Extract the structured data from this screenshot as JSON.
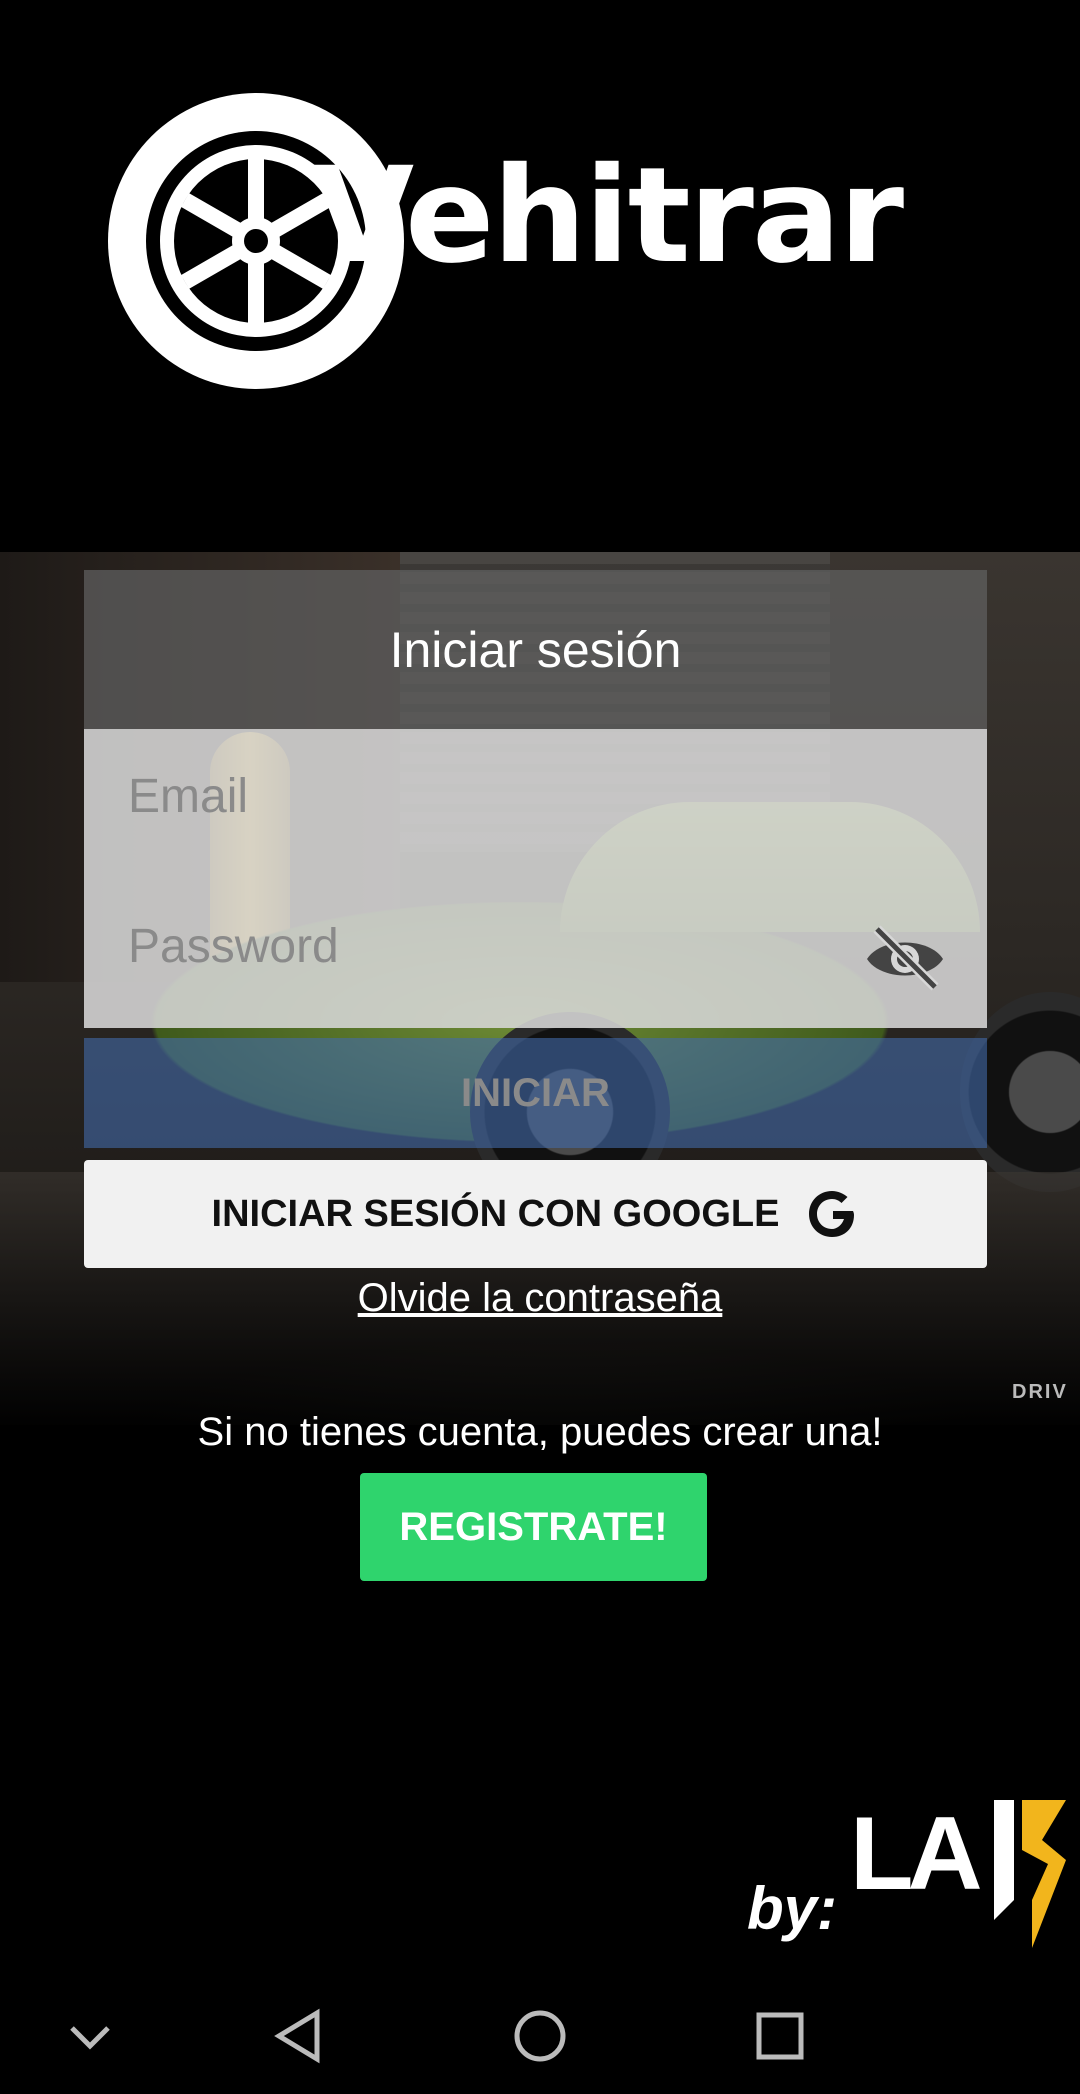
{
  "brand": {
    "name": "Vehitrar"
  },
  "login": {
    "title": "Iniciar sesión",
    "email_placeholder": "Email",
    "password_placeholder": "Password",
    "submit_label": "INICIAR",
    "google_label": "INICIAR SESIÓN CON GOOGLE",
    "forgot_label": "Olvide la contraseña"
  },
  "signup": {
    "prompt": "Si no tienes cuenta, puedes crear una!",
    "button_label": "REGISTRATE!"
  },
  "footer": {
    "by_label": "by:",
    "company": "LA",
    "company_suffix": "J3"
  },
  "background": {
    "watermark": "DRIV"
  },
  "icons": {
    "logo": "wheel-icon",
    "password_toggle": "eye-off-icon",
    "google": "google-g-icon",
    "nav": [
      "chevron-down-icon",
      "back-triangle-icon",
      "home-circle-icon",
      "recents-square-icon"
    ]
  },
  "colors": {
    "background": "#000000",
    "register_button": "#2fd46d",
    "google_button": "#f1f1f1",
    "accent_yellow": "#f2b51c",
    "iniciar_button": "#426aaa"
  }
}
